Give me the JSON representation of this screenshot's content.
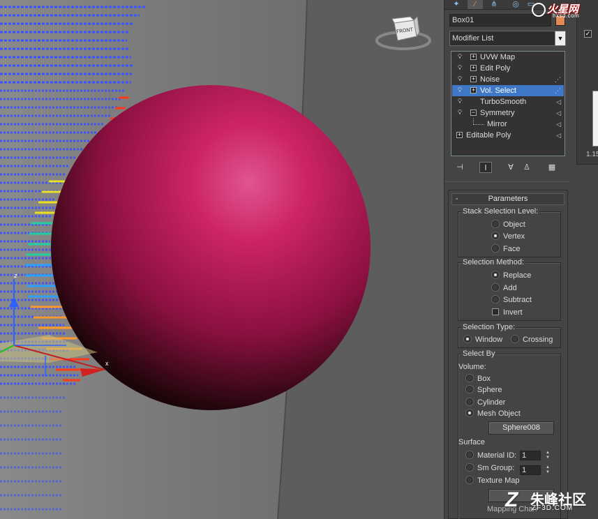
{
  "viewport": {
    "viewcube_label": "FRONT",
    "gizmo_label": "x",
    "colors": {
      "background": "#5c5c5c",
      "sphere": "#c21c5b",
      "wire": "#3a52ff"
    }
  },
  "panel": {
    "object_name": "Box01",
    "object_color": "#e38a54",
    "modifier_list_label": "Modifier List",
    "stack": [
      {
        "label": "UVW Map",
        "expandable": true,
        "selected": false
      },
      {
        "label": "Edit Poly",
        "expandable": true,
        "selected": false
      },
      {
        "label": "Noise",
        "expandable": true,
        "selected": false
      },
      {
        "label": "Vol. Select",
        "expandable": true,
        "selected": true
      },
      {
        "label": "TurboSmooth",
        "expandable": false,
        "selected": false
      },
      {
        "label": "Symmetry",
        "expandable": true,
        "selected": false
      },
      {
        "label": "Mirror",
        "expandable": false,
        "selected": false
      },
      {
        "label": "Editable Poly",
        "expandable": true,
        "selected": false
      }
    ],
    "parameters": {
      "title": "Parameters",
      "stack_selection_level": {
        "label": "Stack Selection Level:",
        "options": [
          "Object",
          "Vertex",
          "Face"
        ],
        "selected": "Vertex"
      },
      "selection_method": {
        "label": "Selection Method:",
        "options": [
          "Replace",
          "Add",
          "Subtract"
        ],
        "selected": "Replace",
        "invert_label": "Invert"
      },
      "selection_type": {
        "label": "Selection Type:",
        "options": [
          "Window",
          "Crossing"
        ],
        "selected": "Window"
      },
      "select_by": {
        "label": "Select By",
        "volume_label": "Volume:",
        "volume_options": [
          "Box",
          "Sphere",
          "Cylinder",
          "Mesh Object"
        ],
        "volume_selected": "Mesh Object",
        "mesh_object_button": "Sphere008",
        "surface_label": "Surface",
        "material_id_label": "Material ID:",
        "material_id_value": "1",
        "sm_group_label": "Sm Group:",
        "sm_group_value": "1",
        "texture_map_label": "Texture Map",
        "mapping_label": "Mapping Chan"
      }
    },
    "side": {
      "number": "1.15"
    }
  },
  "watermarks": {
    "top_brand": "火星网",
    "top_url": "hxsd.com",
    "bottom_brand": "朱峰社区",
    "bottom_url": "ZF3D.COM"
  }
}
